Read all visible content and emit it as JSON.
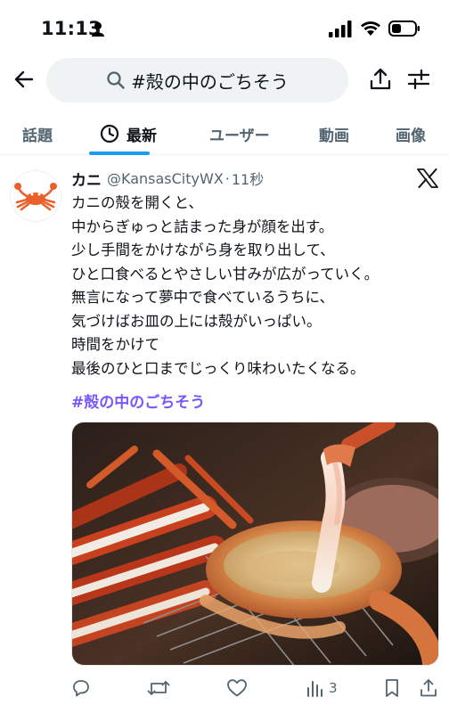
{
  "status_bar": {
    "time": "11:13",
    "icons": [
      "person-icon",
      "signal-icon",
      "wifi-icon",
      "battery-icon"
    ]
  },
  "header": {
    "search_query": "#殻の中のごちそう",
    "icons": [
      "back-arrow-icon",
      "search-icon",
      "share-icon",
      "filter-icon"
    ]
  },
  "tabs": [
    {
      "label": "話題",
      "active": false
    },
    {
      "label": "最新",
      "active": true,
      "icon": "clock-icon"
    },
    {
      "label": "ユーザー",
      "active": false
    },
    {
      "label": "動画",
      "active": false
    },
    {
      "label": "画像",
      "active": false
    }
  ],
  "tweet": {
    "author_name": "カニ",
    "handle": "@KansasCityWX",
    "separator": "·",
    "time": "11秒",
    "lines": [
      "カニの殻を開くと、",
      "中からぎゅっと詰まった身が顔を出す。",
      "少し手間をかけながら身を取り出して、",
      "ひと口食べるとやさしい甘みが広がっていく。",
      "無言になって夢中で食べているうちに、",
      "気づけばお皿の上には殻がいっぱい。",
      "時間をかけて",
      "最後のひと口までじっくり味わいたくなる。"
    ],
    "hashtag": "#殻の中のごちそう",
    "photo_alt_icon": "crab-photo",
    "actions": {
      "reply_icon": "reply-icon",
      "retweet_icon": "retweet-icon",
      "like_icon": "heart-icon",
      "views_icon": "views-icon",
      "views_count": "3",
      "bookmark_icon": "bookmark-icon",
      "share_icon": "share-icon"
    }
  },
  "colors": {
    "accent": "#1d9bf0",
    "hashtag": "#7856ff",
    "muted_text": "#536471",
    "search_bg": "#eff3f4"
  }
}
